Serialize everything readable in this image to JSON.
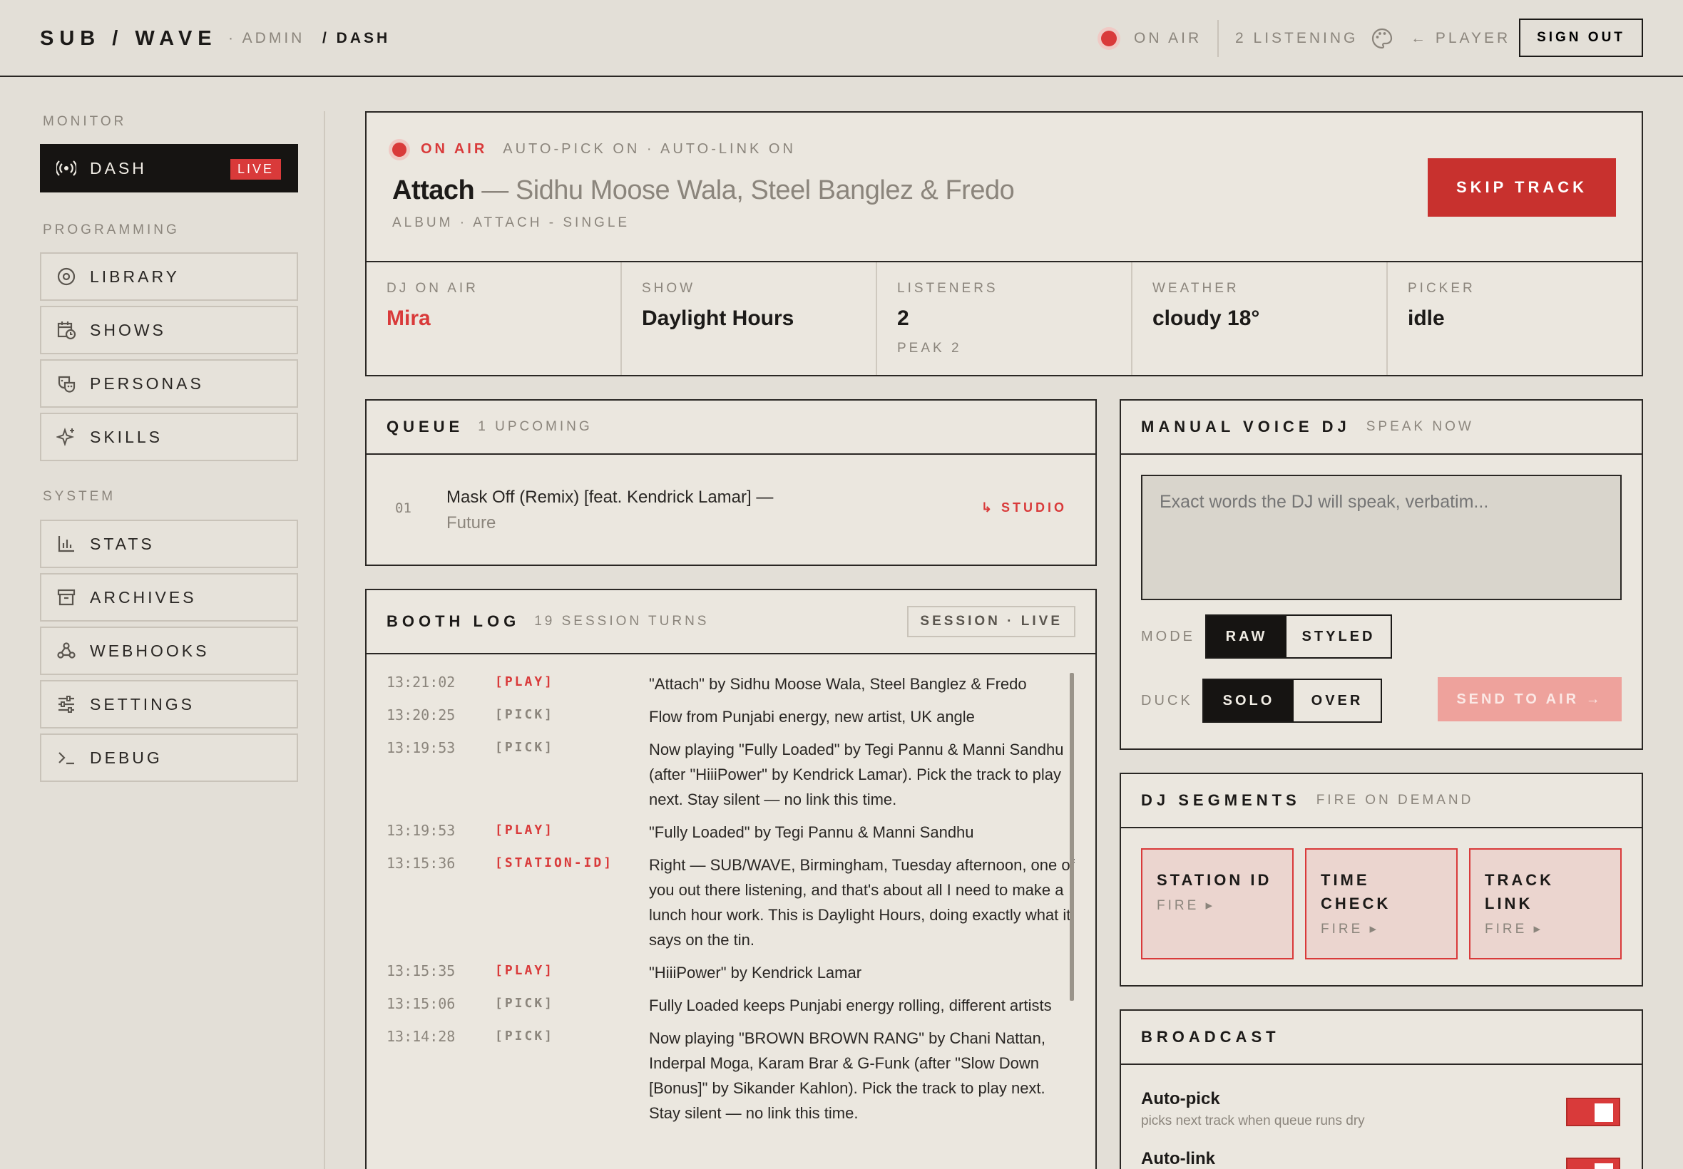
{
  "topbar": {
    "logo": "SUB / WAVE",
    "crumbs": [
      "· ADMIN",
      "/ DASH"
    ],
    "onair": "ON AIR",
    "listening": "2 LISTENING",
    "player_link": "← PLAYER",
    "signout": "SIGN OUT"
  },
  "sidebar": {
    "sections": [
      "MONITOR",
      "PROGRAMMING",
      "SYSTEM"
    ],
    "items": [
      {
        "label": "DASH",
        "icon": "broadcast-icon",
        "badge": "LIVE"
      },
      {
        "label": "LIBRARY",
        "icon": "disc-icon"
      },
      {
        "label": "SHOWS",
        "icon": "calendar-clock-icon"
      },
      {
        "label": "PERSONAS",
        "icon": "masks-icon"
      },
      {
        "label": "SKILLS",
        "icon": "sparkle-icon"
      },
      {
        "label": "STATS",
        "icon": "bar-chart-icon"
      },
      {
        "label": "ARCHIVES",
        "icon": "archive-icon"
      },
      {
        "label": "WEBHOOKS",
        "icon": "webhook-icon"
      },
      {
        "label": "SETTINGS",
        "icon": "sliders-icon"
      },
      {
        "label": "DEBUG",
        "icon": "terminal-icon"
      }
    ]
  },
  "now_playing": {
    "onair": "ON AIR",
    "flags": "AUTO-PICK ON · AUTO-LINK ON",
    "title": "Attach",
    "artist": "— Sidhu Moose Wala, Steel Banglez & Fredo",
    "album": "ALBUM · ATTACH - SINGLE",
    "skip": "SKIP TRACK",
    "stats": [
      {
        "label": "DJ ON AIR",
        "value": "Mira",
        "sub": ""
      },
      {
        "label": "SHOW",
        "value": "Daylight Hours",
        "sub": ""
      },
      {
        "label": "LISTENERS",
        "value": "2",
        "sub": "PEAK 2"
      },
      {
        "label": "WEATHER",
        "value": "cloudy 18°",
        "sub": ""
      },
      {
        "label": "PICKER",
        "value": "idle",
        "sub": ""
      }
    ]
  },
  "queue": {
    "title": "QUEUE",
    "count": "1 UPCOMING",
    "items": [
      {
        "num": "01",
        "track": "Mask Off (Remix) [feat. Kendrick Lamar] —",
        "artist": "Future",
        "tag": "↳ STUDIO"
      }
    ]
  },
  "booth_log": {
    "title": "BOOTH LOG",
    "count": "19 SESSION TURNS",
    "session": "SESSION · LIVE",
    "rows": [
      {
        "time": "13:21:02",
        "tag": "[PLAY]",
        "text": "\"Attach\" by Sidhu Moose Wala, Steel Banglez & Fredo"
      },
      {
        "time": "13:20:25",
        "tag": "[PICK]",
        "text": "Flow from Punjabi energy, new artist, UK angle"
      },
      {
        "time": "13:19:53",
        "tag": "[PICK]",
        "text": "Now playing \"Fully Loaded\" by Tegi Pannu & Manni Sandhu (after \"HiiiPower\" by Kendrick Lamar). Pick the track to play next. Stay silent — no link this time."
      },
      {
        "time": "13:19:53",
        "tag": "[PLAY]",
        "text": "\"Fully Loaded\" by Tegi Pannu & Manni Sandhu"
      },
      {
        "time": "13:15:36",
        "tag": "[STATION-ID]",
        "text": "Right — SUB/WAVE, Birmingham, Tuesday afternoon, one of you out there listening, and that's about all I need to make a lunch hour work. This is Daylight Hours, doing exactly what it says on the tin."
      },
      {
        "time": "13:15:35",
        "tag": "[PLAY]",
        "text": "\"HiiiPower\" by Kendrick Lamar"
      },
      {
        "time": "13:15:06",
        "tag": "[PICK]",
        "text": "Fully Loaded keeps Punjabi energy rolling, different artists"
      },
      {
        "time": "13:14:28",
        "tag": "[PICK]",
        "text": "Now playing \"BROWN BROWN RANG\" by Chani Nattan, Inderpal Moga, Karam Brar & G-Funk (after \"Slow Down [Bonus]\" by Sikander Kahlon). Pick the track to play next. Stay silent — no link this time."
      }
    ]
  },
  "voice_dj": {
    "title": "MANUAL VOICE DJ",
    "sub": "SPEAK NOW",
    "placeholder": "Exact words the DJ will speak, verbatim...",
    "mode_label": "MODE",
    "mode_options": [
      "RAW",
      "STYLED"
    ],
    "mode_selected": "RAW",
    "duck_label": "DUCK",
    "duck_options": [
      "SOLO",
      "OVER"
    ],
    "duck_selected": "SOLO",
    "send": "SEND TO AIR →"
  },
  "dj_segments": {
    "title": "DJ SEGMENTS",
    "sub": "FIRE ON DEMAND",
    "cards": [
      {
        "name": "STATION ID",
        "fire": "FIRE ▸"
      },
      {
        "name": "TIME CHECK",
        "fire": "FIRE ▸"
      },
      {
        "name": "TRACK LINK",
        "fire": "FIRE ▸"
      }
    ]
  },
  "broadcast": {
    "title": "BROADCAST",
    "rows": [
      {
        "name": "Auto-pick",
        "desc": "picks next track when queue runs dry",
        "on": true
      },
      {
        "name": "Auto-link",
        "desc": "",
        "on": true
      }
    ]
  },
  "colors": {
    "accent": "#d93a3a",
    "ink": "#161412",
    "bg": "#e3dfd7"
  }
}
